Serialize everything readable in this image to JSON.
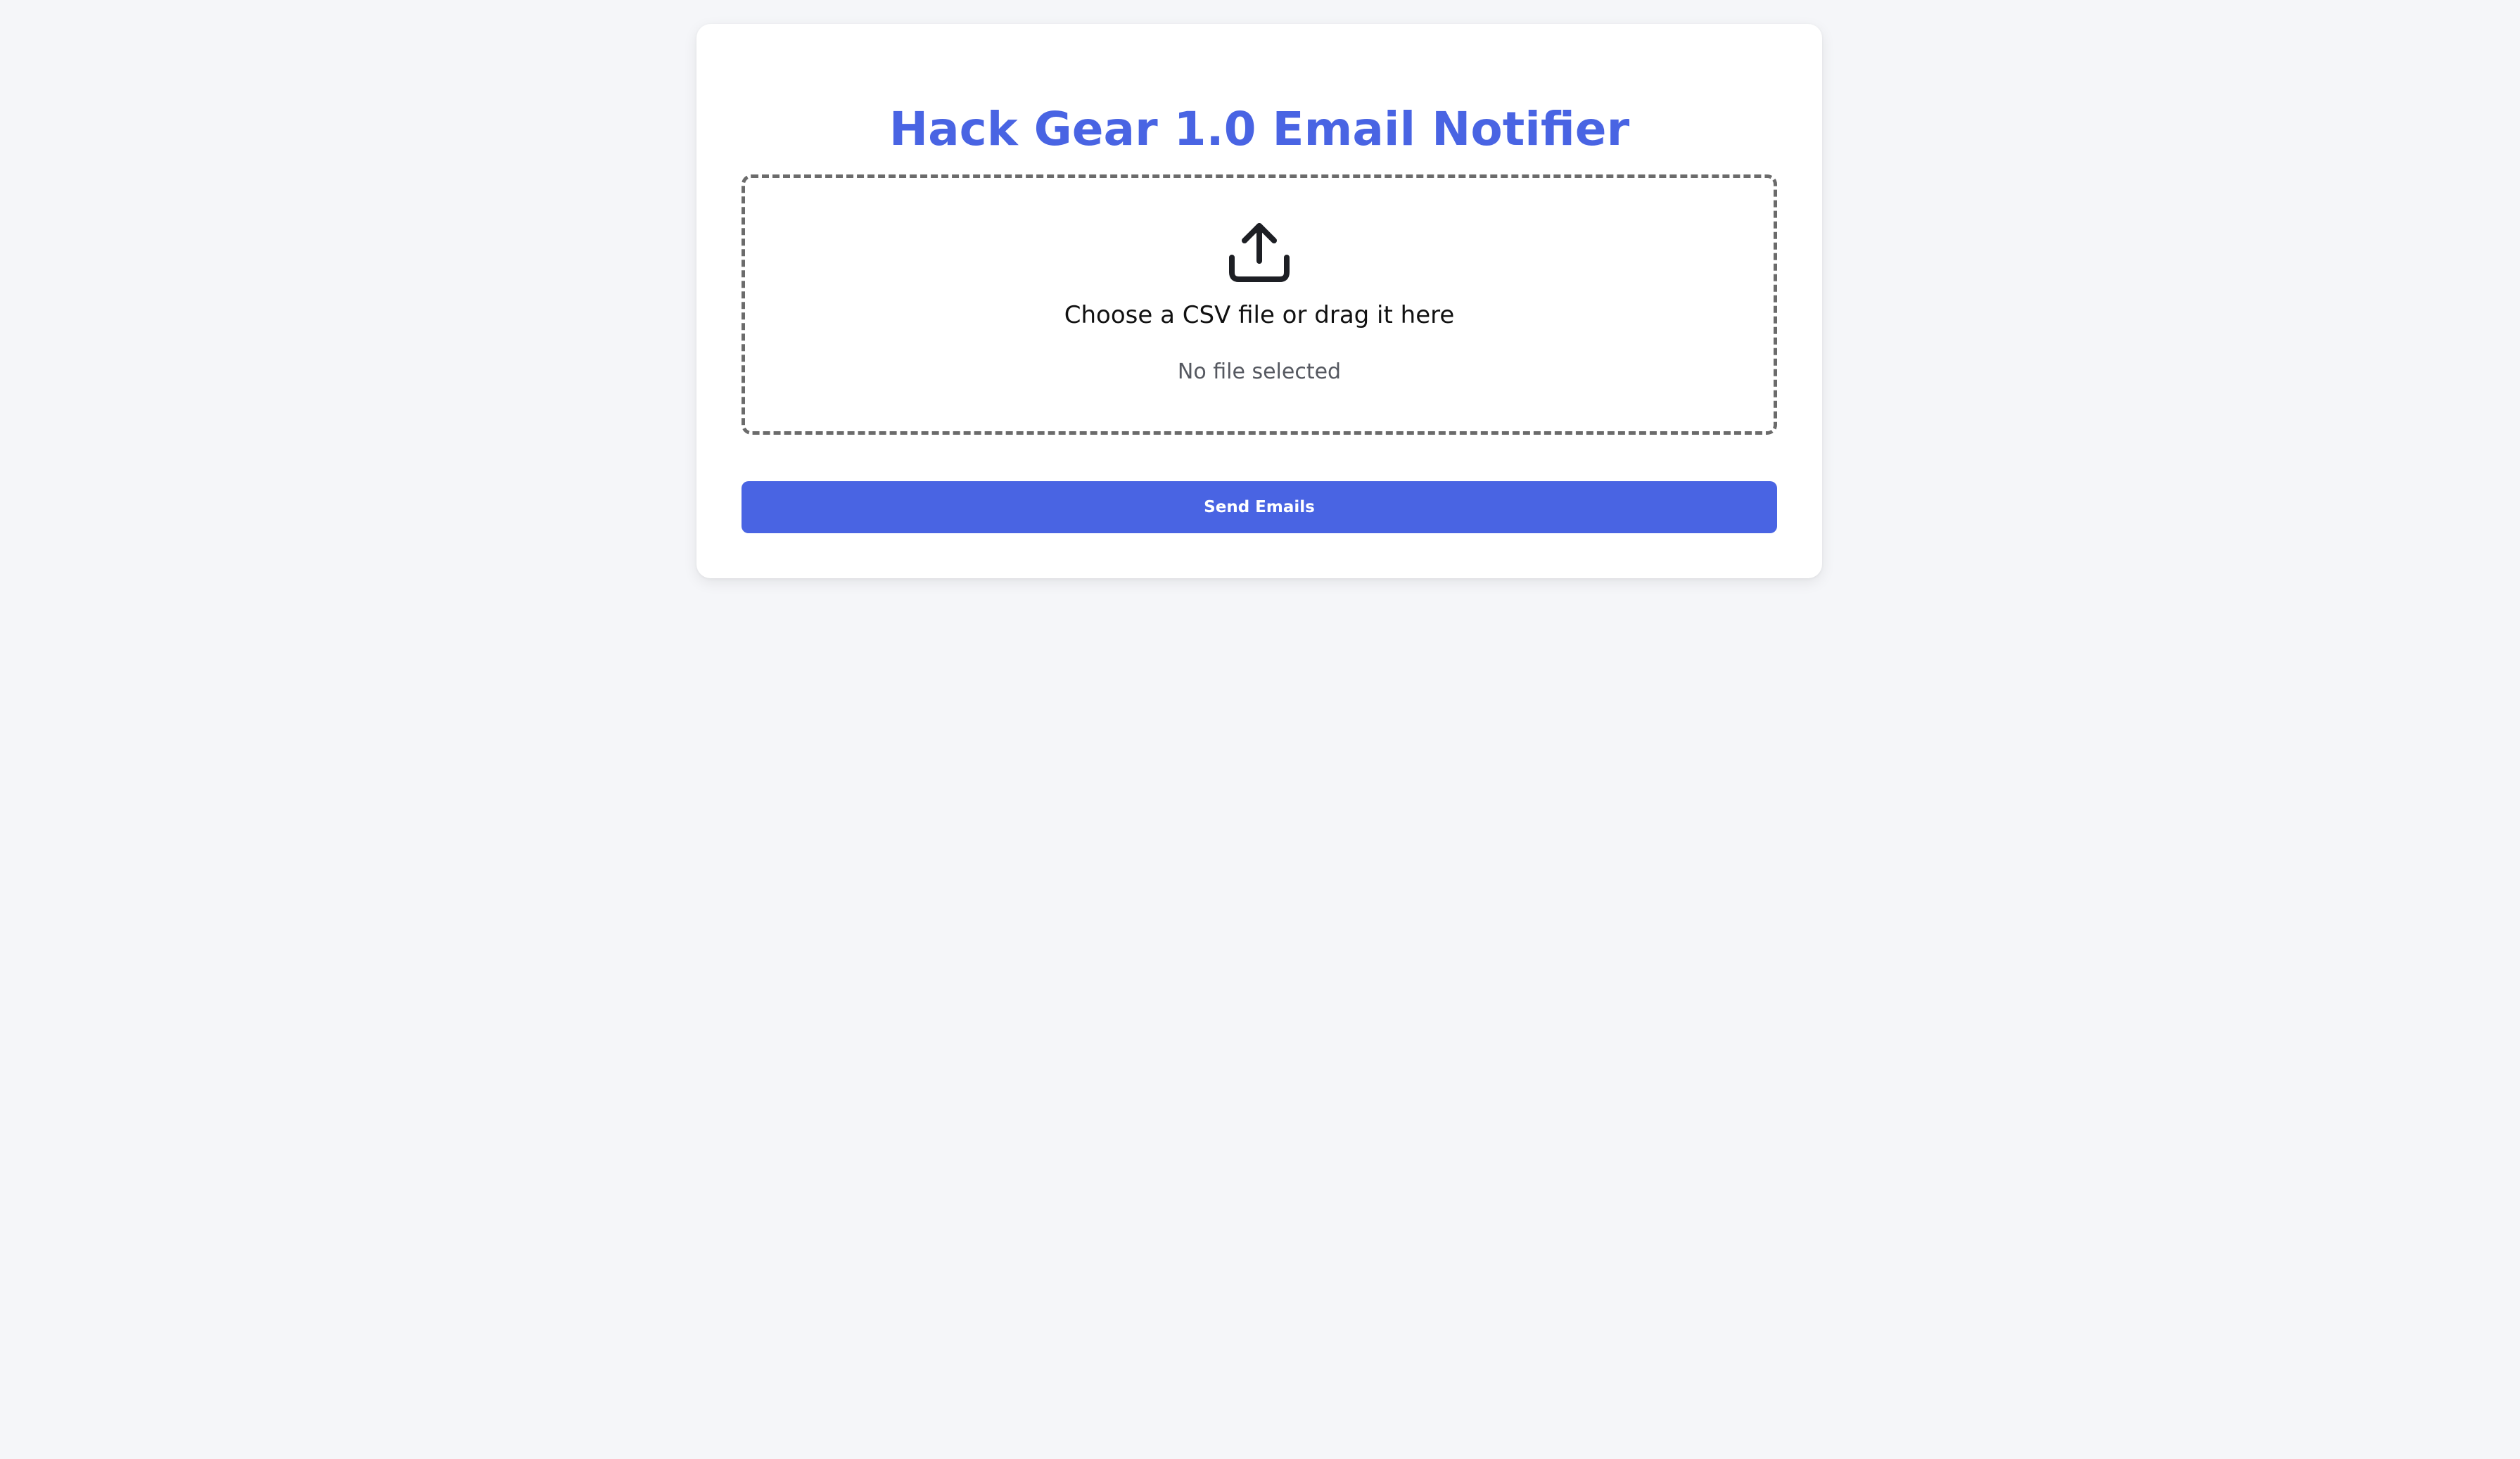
{
  "page": {
    "title": "Hack Gear 1.0 Email Notifier"
  },
  "upload": {
    "icon": "upload-icon",
    "prompt": "Choose a CSV file or drag it here",
    "status": "No file selected"
  },
  "actions": {
    "send_label": "Send Emails"
  },
  "colors": {
    "accent": "#4964e3",
    "background": "#f5f6f9",
    "card": "#ffffff",
    "dropzone_border": "#6b6b6b",
    "muted_text": "#555860"
  }
}
